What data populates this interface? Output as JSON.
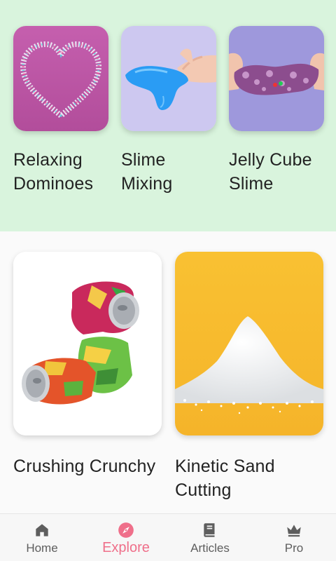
{
  "colors": {
    "top_background": "#d9f4dd",
    "page_background": "#fafafa",
    "accent": "#ef6f8a",
    "nav_inactive": "#5e5e5e"
  },
  "featured": [
    {
      "title_line1": "Relaxing",
      "title_line2": "Dominoes",
      "image": "heart-dominoes-image"
    },
    {
      "title_line1": "Slime",
      "title_line2": "Mixing",
      "image": "blue-slime-hand-image"
    },
    {
      "title_line1": "Jelly Cube",
      "title_line2": "Slime",
      "image": "purple-slime-image"
    }
  ],
  "videos": [
    {
      "title_line1": "Crushing Crunchy",
      "title_line2": "",
      "image": "crushed-cans-image"
    },
    {
      "title_line1": "Kinetic Sand",
      "title_line2": "Cutting",
      "image": "sand-pile-image"
    }
  ],
  "nav": {
    "items": [
      {
        "label": "Home",
        "icon": "home-icon",
        "active": false
      },
      {
        "label": "Explore",
        "icon": "compass-icon",
        "active": true
      },
      {
        "label": "Articles",
        "icon": "book-icon",
        "active": false
      },
      {
        "label": "Pro",
        "icon": "crown-icon",
        "active": false
      }
    ]
  }
}
